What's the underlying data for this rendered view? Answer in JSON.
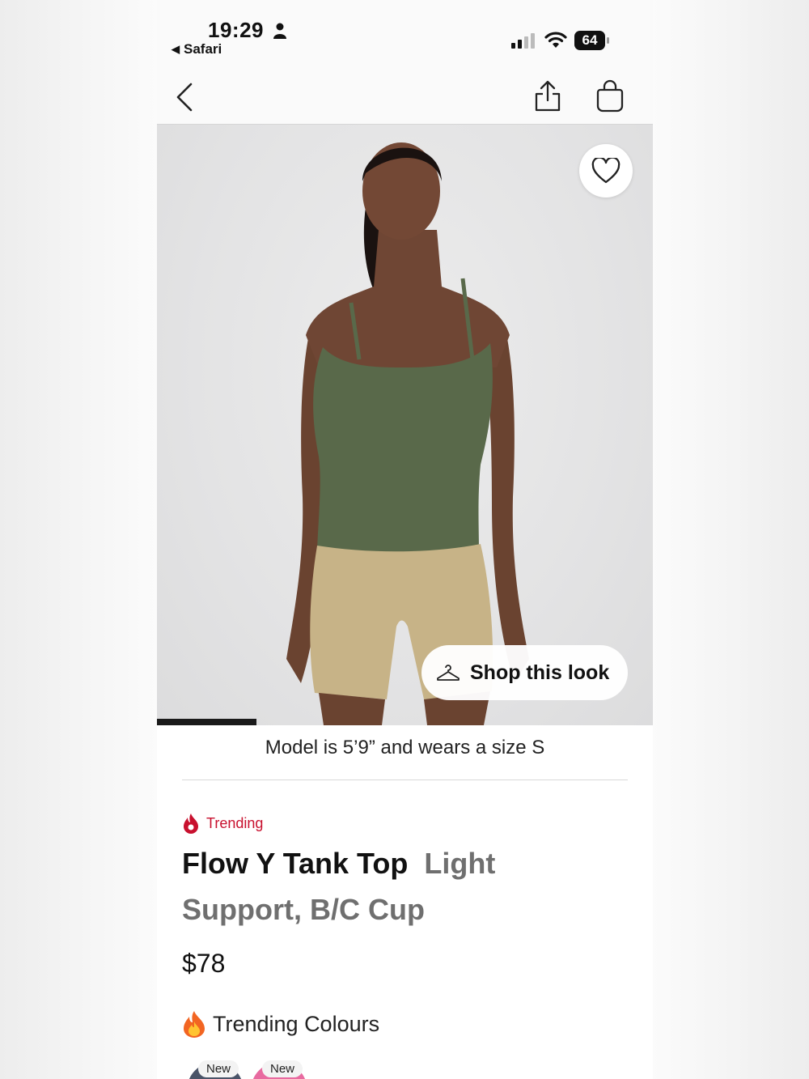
{
  "status_bar": {
    "time": "19:29",
    "back_app": "Safari",
    "battery": "64"
  },
  "hero": {
    "shop_look_label": "Shop this look",
    "image_progress": 0.2
  },
  "product": {
    "model_info": "Model is 5’9” and wears a size S",
    "trending_label": "Trending",
    "name": "Flow Y Tank Top",
    "subtitle": "Light Support, B/C Cup",
    "price": "$78",
    "trending_colours_label": "Trending Colours",
    "swatches": [
      {
        "tag": "New",
        "color": "#4a5468"
      },
      {
        "tag": "New",
        "color": "#e86aa0"
      }
    ]
  },
  "colors": {
    "accent": "#c8102e",
    "tank": "#59694a",
    "shorts": "#c7b387"
  }
}
